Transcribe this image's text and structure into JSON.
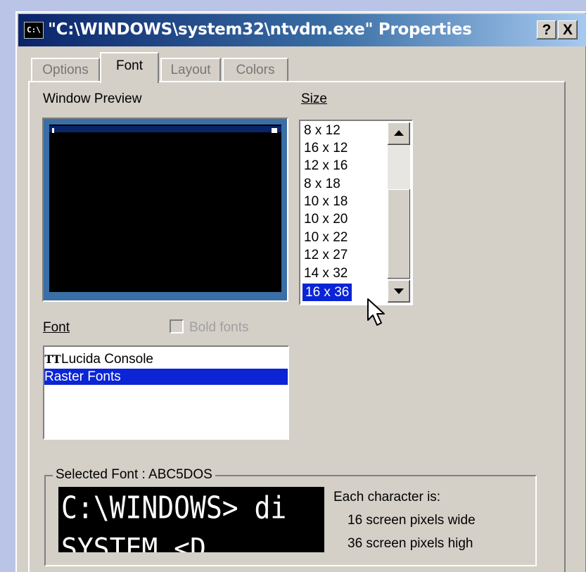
{
  "window": {
    "title": "\"C:\\WINDOWS\\system32\\ntvdm.exe\" Properties",
    "icon_text": "C:\\",
    "help_button": "?",
    "close_button": "X"
  },
  "tabs": [
    {
      "label": "Options",
      "active": false
    },
    {
      "label": "Font",
      "active": true
    },
    {
      "label": "Layout",
      "active": false
    },
    {
      "label": "Colors",
      "active": false
    }
  ],
  "preview": {
    "label": "Window Preview"
  },
  "size": {
    "label": "Size",
    "items": [
      "8 x 12",
      "16 x 12",
      "12 x 16",
      "8 x 18",
      "10 x 18",
      "10 x 20",
      "10 x 22",
      "12 x 27",
      "14 x 32",
      "16 x 36"
    ],
    "selected": "16 x 36"
  },
  "font": {
    "label": "Font",
    "bold_label": "Bold fonts",
    "bold_checked": false,
    "items": [
      "Lucida Console",
      "Raster Fonts"
    ],
    "selected": "Raster Fonts",
    "truetype_icon": "TT"
  },
  "selected_font": {
    "title": "Selected Font : ABC5DOS",
    "sample_line1": "C:\\WINDOWS> di",
    "sample_line2": "SYSTEM        <D",
    "desc_title": "Each character is:",
    "desc_wide": "16 screen pixels wide",
    "desc_high": "36 screen pixels high"
  },
  "colors": {
    "desktop": "#b9c4e6",
    "title_start": "#0a246a",
    "title_end": "#a6caf0",
    "face": "#d4d0c8",
    "selection": "#0a24d6"
  },
  "icons": [
    "console-icon",
    "help-icon",
    "close-icon",
    "truetype-font-icon",
    "scroll-up-icon",
    "scroll-down-icon",
    "mouse-pointer-icon"
  ]
}
